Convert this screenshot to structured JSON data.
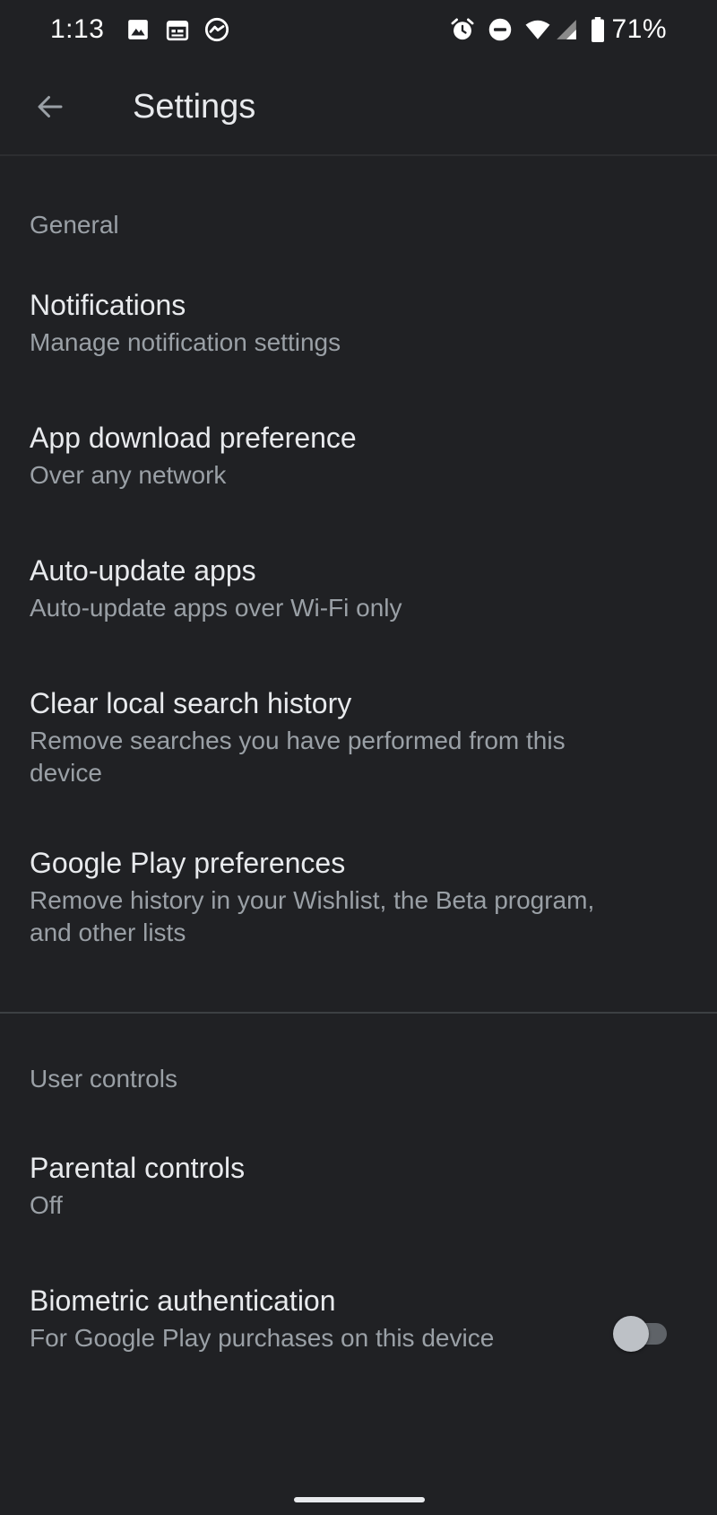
{
  "status_bar": {
    "time": "1:13",
    "battery": "71%",
    "left_icons": [
      "image-icon",
      "calendar-icon",
      "messenger-icon"
    ],
    "right_icons": [
      "alarm-icon",
      "do-not-disturb-icon",
      "wifi-icon",
      "signal-icon",
      "battery-icon"
    ]
  },
  "app_bar": {
    "title": "Settings",
    "back_icon": "arrow-back-icon"
  },
  "sections": {
    "general": {
      "header": "General",
      "items": [
        {
          "title": "Notifications",
          "subtitle": "Manage notification settings"
        },
        {
          "title": "App download preference",
          "subtitle": "Over any network"
        },
        {
          "title": "Auto-update apps",
          "subtitle": "Auto-update apps over Wi-Fi only"
        },
        {
          "title": "Clear local search history",
          "subtitle": "Remove searches you have performed from this device"
        },
        {
          "title": "Google Play preferences",
          "subtitle": "Remove history in your Wishlist, the Beta program, and other lists"
        }
      ]
    },
    "user_controls": {
      "header": "User controls",
      "items": [
        {
          "title": "Parental controls",
          "subtitle": "Off"
        },
        {
          "title": "Biometric authentication",
          "subtitle": "For Google Play purchases on this device",
          "toggle_on": false
        }
      ]
    }
  },
  "colors": {
    "background": "#202124",
    "primary_text": "#e8eaed",
    "secondary_text": "#9aa0a6",
    "divider": "#3c4043"
  }
}
